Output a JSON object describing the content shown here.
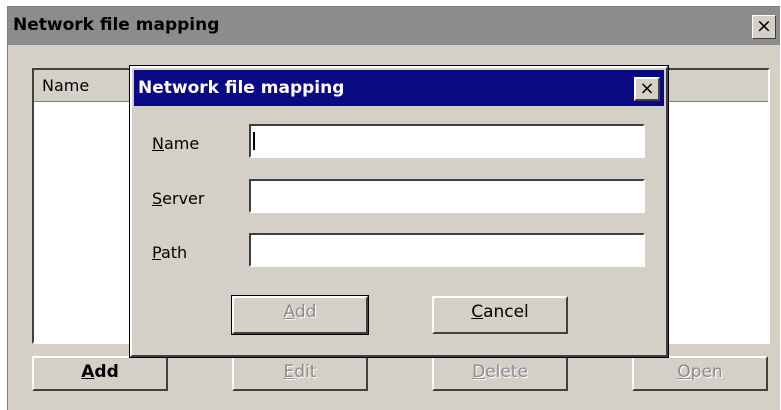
{
  "outer": {
    "title": "Network file mapping",
    "close_label": "×",
    "list": {
      "columns": [
        "Name"
      ]
    },
    "buttons": {
      "add": {
        "key": "A",
        "rest": "dd"
      },
      "edit": {
        "key": "E",
        "rest": "dit"
      },
      "delete": {
        "key": "D",
        "rest": "elete"
      },
      "open": {
        "key": "O",
        "rest": "pen"
      }
    }
  },
  "dialog": {
    "title": "Network file mapping",
    "close_label": "×",
    "fields": {
      "name": {
        "key": "N",
        "rest": "ame",
        "value": ""
      },
      "server": {
        "key": "S",
        "rest": "erver",
        "value": ""
      },
      "path": {
        "key": "P",
        "rest": "ath",
        "value": ""
      }
    },
    "buttons": {
      "add": {
        "key": "A",
        "rest": "dd"
      },
      "cancel": {
        "key": "C",
        "rest": "ancel"
      }
    }
  }
}
